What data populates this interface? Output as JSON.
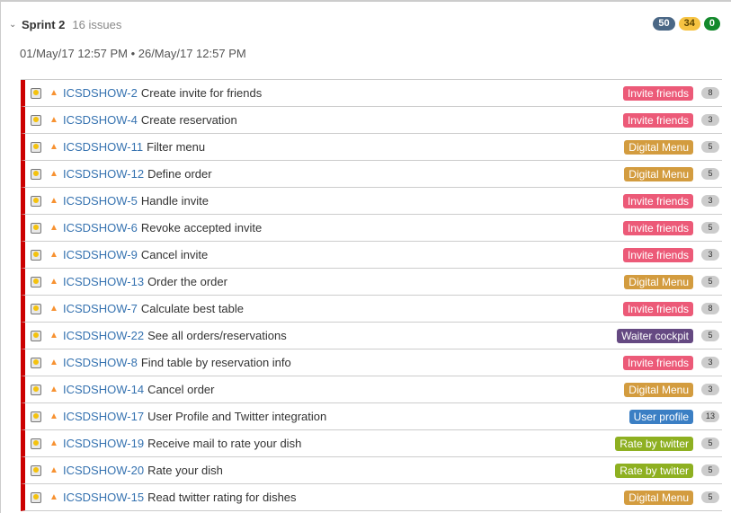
{
  "sprint": {
    "name": "Sprint 2",
    "issue_count": "16 issues",
    "dates": "01/May/17 12:57 PM • 26/May/17 12:57 PM",
    "status_counts": {
      "todo": "50",
      "in_progress": "34",
      "done": "0"
    }
  },
  "epic_colors": {
    "Invite friends": "#ec5a78",
    "Digital Menu": "#d39c3f",
    "Waiter cockpit": "#654982",
    "User profile": "#3b7fc4",
    "Rate by twitter": "#8eb021"
  },
  "issues": [
    {
      "key": "ICSDSHOW-2",
      "summary": "Create invite for friends",
      "epic": "Invite friends",
      "estimate": "8"
    },
    {
      "key": "ICSDSHOW-4",
      "summary": "Create reservation",
      "epic": "Invite friends",
      "estimate": "3"
    },
    {
      "key": "ICSDSHOW-11",
      "summary": "Filter menu",
      "epic": "Digital Menu",
      "estimate": "5"
    },
    {
      "key": "ICSDSHOW-12",
      "summary": "Define order",
      "epic": "Digital Menu",
      "estimate": "5"
    },
    {
      "key": "ICSDSHOW-5",
      "summary": "Handle invite",
      "epic": "Invite friends",
      "estimate": "3"
    },
    {
      "key": "ICSDSHOW-6",
      "summary": "Revoke accepted invite",
      "epic": "Invite friends",
      "estimate": "5"
    },
    {
      "key": "ICSDSHOW-9",
      "summary": "Cancel invite",
      "epic": "Invite friends",
      "estimate": "3"
    },
    {
      "key": "ICSDSHOW-13",
      "summary": "Order the order",
      "epic": "Digital Menu",
      "estimate": "5"
    },
    {
      "key": "ICSDSHOW-7",
      "summary": "Calculate best table",
      "epic": "Invite friends",
      "estimate": "8"
    },
    {
      "key": "ICSDSHOW-22",
      "summary": "See all orders/reservations",
      "epic": "Waiter cockpit",
      "estimate": "5"
    },
    {
      "key": "ICSDSHOW-8",
      "summary": "Find table by reservation info",
      "epic": "Invite friends",
      "estimate": "3"
    },
    {
      "key": "ICSDSHOW-14",
      "summary": "Cancel order",
      "epic": "Digital Menu",
      "estimate": "3"
    },
    {
      "key": "ICSDSHOW-17",
      "summary": "User Profile and Twitter integration",
      "epic": "User profile",
      "estimate": "13"
    },
    {
      "key": "ICSDSHOW-19",
      "summary": "Receive mail to rate your dish",
      "epic": "Rate by twitter",
      "estimate": "5"
    },
    {
      "key": "ICSDSHOW-20",
      "summary": "Rate your dish",
      "epic": "Rate by twitter",
      "estimate": "5"
    },
    {
      "key": "ICSDSHOW-15",
      "summary": "Read twitter rating for dishes",
      "epic": "Digital Menu",
      "estimate": "5"
    }
  ],
  "icons": {
    "collapse": "chevron-down-icon",
    "type": "story-lightbulb-icon",
    "priority": "priority-up-arrow-icon"
  }
}
